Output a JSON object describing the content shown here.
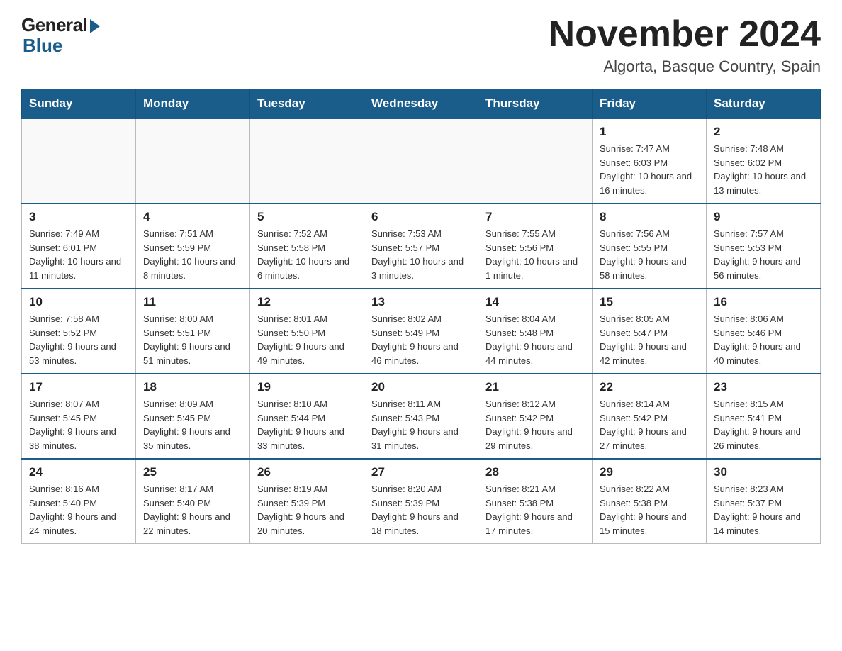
{
  "header": {
    "logo_general": "General",
    "logo_blue": "Blue",
    "title": "November 2024",
    "subtitle": "Algorta, Basque Country, Spain"
  },
  "weekdays": [
    "Sunday",
    "Monday",
    "Tuesday",
    "Wednesday",
    "Thursday",
    "Friday",
    "Saturday"
  ],
  "weeks": [
    [
      {
        "day": "",
        "info": ""
      },
      {
        "day": "",
        "info": ""
      },
      {
        "day": "",
        "info": ""
      },
      {
        "day": "",
        "info": ""
      },
      {
        "day": "",
        "info": ""
      },
      {
        "day": "1",
        "info": "Sunrise: 7:47 AM\nSunset: 6:03 PM\nDaylight: 10 hours\nand 16 minutes."
      },
      {
        "day": "2",
        "info": "Sunrise: 7:48 AM\nSunset: 6:02 PM\nDaylight: 10 hours\nand 13 minutes."
      }
    ],
    [
      {
        "day": "3",
        "info": "Sunrise: 7:49 AM\nSunset: 6:01 PM\nDaylight: 10 hours\nand 11 minutes."
      },
      {
        "day": "4",
        "info": "Sunrise: 7:51 AM\nSunset: 5:59 PM\nDaylight: 10 hours\nand 8 minutes."
      },
      {
        "day": "5",
        "info": "Sunrise: 7:52 AM\nSunset: 5:58 PM\nDaylight: 10 hours\nand 6 minutes."
      },
      {
        "day": "6",
        "info": "Sunrise: 7:53 AM\nSunset: 5:57 PM\nDaylight: 10 hours\nand 3 minutes."
      },
      {
        "day": "7",
        "info": "Sunrise: 7:55 AM\nSunset: 5:56 PM\nDaylight: 10 hours\nand 1 minute."
      },
      {
        "day": "8",
        "info": "Sunrise: 7:56 AM\nSunset: 5:55 PM\nDaylight: 9 hours\nand 58 minutes."
      },
      {
        "day": "9",
        "info": "Sunrise: 7:57 AM\nSunset: 5:53 PM\nDaylight: 9 hours\nand 56 minutes."
      }
    ],
    [
      {
        "day": "10",
        "info": "Sunrise: 7:58 AM\nSunset: 5:52 PM\nDaylight: 9 hours\nand 53 minutes."
      },
      {
        "day": "11",
        "info": "Sunrise: 8:00 AM\nSunset: 5:51 PM\nDaylight: 9 hours\nand 51 minutes."
      },
      {
        "day": "12",
        "info": "Sunrise: 8:01 AM\nSunset: 5:50 PM\nDaylight: 9 hours\nand 49 minutes."
      },
      {
        "day": "13",
        "info": "Sunrise: 8:02 AM\nSunset: 5:49 PM\nDaylight: 9 hours\nand 46 minutes."
      },
      {
        "day": "14",
        "info": "Sunrise: 8:04 AM\nSunset: 5:48 PM\nDaylight: 9 hours\nand 44 minutes."
      },
      {
        "day": "15",
        "info": "Sunrise: 8:05 AM\nSunset: 5:47 PM\nDaylight: 9 hours\nand 42 minutes."
      },
      {
        "day": "16",
        "info": "Sunrise: 8:06 AM\nSunset: 5:46 PM\nDaylight: 9 hours\nand 40 minutes."
      }
    ],
    [
      {
        "day": "17",
        "info": "Sunrise: 8:07 AM\nSunset: 5:45 PM\nDaylight: 9 hours\nand 38 minutes."
      },
      {
        "day": "18",
        "info": "Sunrise: 8:09 AM\nSunset: 5:45 PM\nDaylight: 9 hours\nand 35 minutes."
      },
      {
        "day": "19",
        "info": "Sunrise: 8:10 AM\nSunset: 5:44 PM\nDaylight: 9 hours\nand 33 minutes."
      },
      {
        "day": "20",
        "info": "Sunrise: 8:11 AM\nSunset: 5:43 PM\nDaylight: 9 hours\nand 31 minutes."
      },
      {
        "day": "21",
        "info": "Sunrise: 8:12 AM\nSunset: 5:42 PM\nDaylight: 9 hours\nand 29 minutes."
      },
      {
        "day": "22",
        "info": "Sunrise: 8:14 AM\nSunset: 5:42 PM\nDaylight: 9 hours\nand 27 minutes."
      },
      {
        "day": "23",
        "info": "Sunrise: 8:15 AM\nSunset: 5:41 PM\nDaylight: 9 hours\nand 26 minutes."
      }
    ],
    [
      {
        "day": "24",
        "info": "Sunrise: 8:16 AM\nSunset: 5:40 PM\nDaylight: 9 hours\nand 24 minutes."
      },
      {
        "day": "25",
        "info": "Sunrise: 8:17 AM\nSunset: 5:40 PM\nDaylight: 9 hours\nand 22 minutes."
      },
      {
        "day": "26",
        "info": "Sunrise: 8:19 AM\nSunset: 5:39 PM\nDaylight: 9 hours\nand 20 minutes."
      },
      {
        "day": "27",
        "info": "Sunrise: 8:20 AM\nSunset: 5:39 PM\nDaylight: 9 hours\nand 18 minutes."
      },
      {
        "day": "28",
        "info": "Sunrise: 8:21 AM\nSunset: 5:38 PM\nDaylight: 9 hours\nand 17 minutes."
      },
      {
        "day": "29",
        "info": "Sunrise: 8:22 AM\nSunset: 5:38 PM\nDaylight: 9 hours\nand 15 minutes."
      },
      {
        "day": "30",
        "info": "Sunrise: 8:23 AM\nSunset: 5:37 PM\nDaylight: 9 hours\nand 14 minutes."
      }
    ]
  ]
}
